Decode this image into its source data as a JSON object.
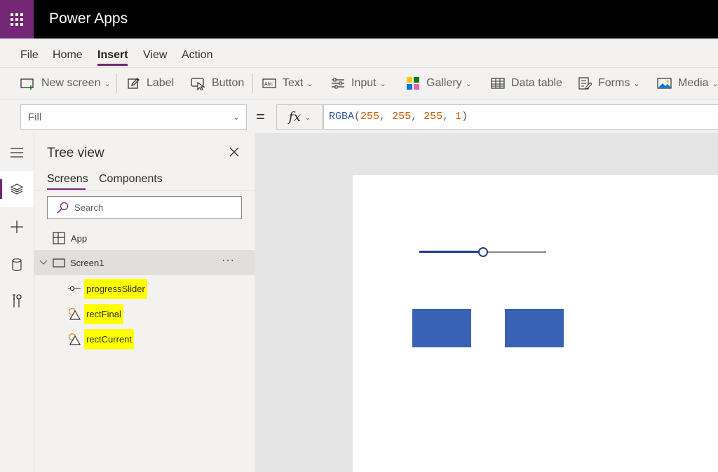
{
  "app": {
    "title": "Power Apps"
  },
  "menu": {
    "items": [
      {
        "label": "File"
      },
      {
        "label": "Home"
      },
      {
        "label": "Insert",
        "active": true
      },
      {
        "label": "View"
      },
      {
        "label": "Action"
      }
    ]
  },
  "toolbar": {
    "new_screen": "New screen",
    "label": "Label",
    "button": "Button",
    "text": "Text",
    "input": "Input",
    "gallery": "Gallery",
    "data_table": "Data table",
    "forms": "Forms",
    "media": "Media"
  },
  "formula": {
    "property": "Fill",
    "equals": "=",
    "fx": "fx",
    "fn": "RGBA",
    "open": "(",
    "a1": "255",
    "c1": ", ",
    "a2": "255",
    "c2": ", ",
    "a3": "255",
    "c3": ", ",
    "a4": "1",
    "close": ")"
  },
  "treeview": {
    "title": "Tree view",
    "tabs": {
      "screens": "Screens",
      "components": "Components"
    },
    "search_placeholder": "Search",
    "app_label": "App",
    "screen_label": "Screen1",
    "more": "···",
    "controls": [
      {
        "label": "progressSlider",
        "icon": "slider-icon"
      },
      {
        "label": "rectFinal",
        "icon": "shapes-icon"
      },
      {
        "label": "rectCurrent",
        "icon": "shapes-icon"
      }
    ]
  },
  "canvas": {
    "slider_value_fraction": 0.5
  },
  "colors": {
    "brand": "#742774",
    "rect_fill": "#3a62b4",
    "slider_fill": "#1f3b8f",
    "highlight": "#ffff00"
  }
}
